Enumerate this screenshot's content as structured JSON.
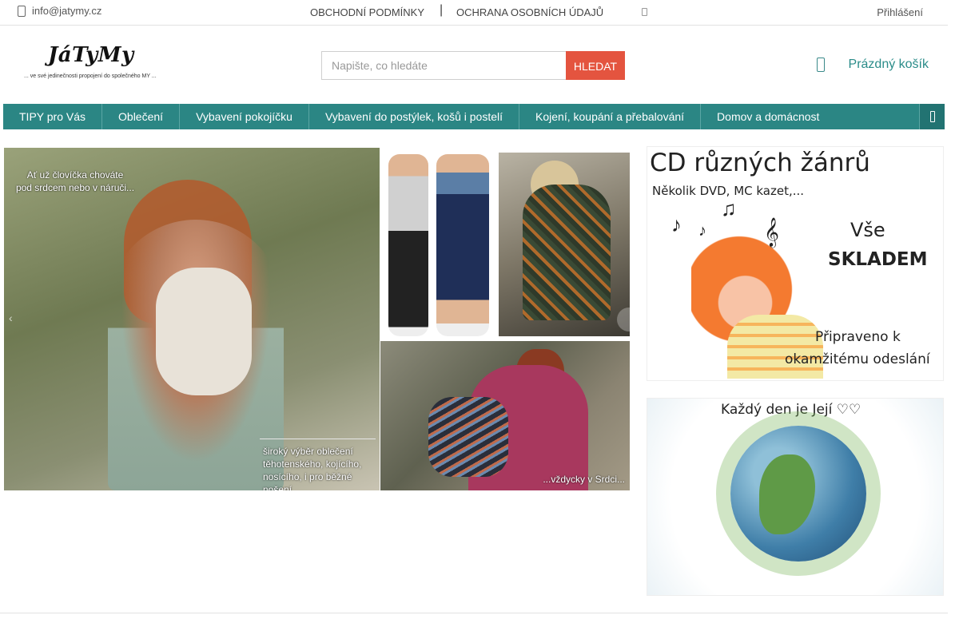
{
  "topbar": {
    "email": "info@jatymy.cz",
    "links": [
      "OBCHODNÍ PODMÍNKY",
      "OCHRANA OSOBNÍCH ÚDAJŮ"
    ],
    "login": "Přihlášení"
  },
  "header": {
    "logo_name": "JáTyMy",
    "logo_tagline": "... ve své jedinečnosti propojení do společného MY ...",
    "search_placeholder": "Napište, co hledáte",
    "search_button": "HLEDAT",
    "cart_label": "Prázdný košík"
  },
  "nav": {
    "items": [
      "TIPY pro Vás",
      "Oblečení",
      "Vybavení pokojíčku",
      "Vybavení do postýlek, košů i postelí",
      "Kojení, koupání a přebalování",
      "Domov a domácnost"
    ]
  },
  "hero": {
    "caption1_line1": "Ať už človíčka chováte",
    "caption1_line2": "pod srdcem nebo v náruči...",
    "caption2_line1": "široký výběr oblečení",
    "caption2_line2": "těhotenského, kojícího,",
    "caption2_line3": "nosícího, i pro běžné nošení",
    "caption3": "...vždycky v Srdci..."
  },
  "banner1": {
    "title": "CD různých žánrů",
    "subtitle": "Několik DVD, MC kazet,...",
    "vse": "Vše",
    "skladem": "SKLADEM",
    "ready1": "Připraveno k",
    "ready2": "okamžitému odeslání"
  },
  "banner2": {
    "title": "Každý den je Její ♡♡"
  },
  "colors": {
    "accent": "#2b8684",
    "button": "#e4543f"
  }
}
